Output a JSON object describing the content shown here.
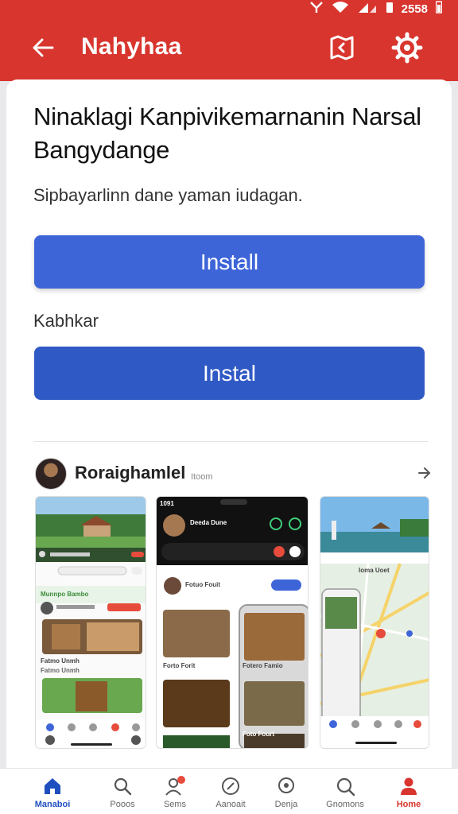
{
  "status_bar": {
    "time": "2558"
  },
  "app_bar": {
    "title": "Nahyhaa",
    "back_icon": "arrow-left-icon",
    "actions": [
      "map-icon",
      "settings-gear-icon"
    ]
  },
  "main": {
    "heading": "Ninaklagi Kanpivikemarnanin Narsal Bangydange",
    "subtext": "Sipbayarlinn dane yaman iudagan.",
    "install_primary": "Install",
    "section_label": "Kabhkar",
    "install_secondary": "Instal"
  },
  "developer": {
    "name": "Roraighamlel",
    "sub": "Itoom"
  },
  "screenshots": {
    "shot1": {
      "header": "Munnpo Bambo",
      "row1": "Fatmo Unmh",
      "row2": "Fatmo Unmh"
    },
    "shot2": {
      "time": "1091",
      "title": "Deeda Dune",
      "subtitle": "Fotuo Fouit",
      "card1": "Forto Forit",
      "card2": "Fotero Famio",
      "card3": "Foto Fourt"
    },
    "shot3": {
      "header": "Ioma Uoet"
    }
  },
  "bottom_nav": [
    {
      "label": "Manaboi",
      "icon": "home-icon"
    },
    {
      "label": "Pooos",
      "icon": "search-icon"
    },
    {
      "label": "Sems",
      "icon": "people-icon",
      "badge": "1"
    },
    {
      "label": "Aanoait",
      "icon": "compass-icon"
    },
    {
      "label": "Denja",
      "icon": "location-pin-icon"
    },
    {
      "label": "Gnomons",
      "icon": "search-icon"
    },
    {
      "label": "Home",
      "icon": "profile-icon"
    }
  ],
  "colors": {
    "primary_red": "#d8352e",
    "button_blue": "#3e65d8",
    "button_blue_dark": "#2f59c4",
    "nav_active": "#1f4fbf"
  }
}
